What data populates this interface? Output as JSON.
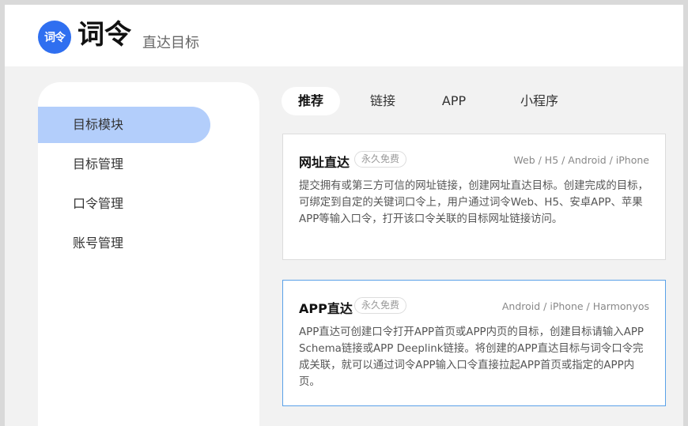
{
  "header": {
    "logo_text": "词令",
    "brand_name": "词令",
    "subtitle": "直达目标"
  },
  "sidebar": {
    "items": [
      {
        "label": "目标模块"
      },
      {
        "label": "目标管理"
      },
      {
        "label": "口令管理"
      },
      {
        "label": "账号管理"
      }
    ]
  },
  "tabs": [
    {
      "label": "推荐"
    },
    {
      "label": "链接"
    },
    {
      "label": "APP"
    },
    {
      "label": "小程序"
    }
  ],
  "cards": [
    {
      "title": "网址直达",
      "badge": "永久免费",
      "platforms": "Web / H5 / Android / iPhone",
      "description": "提交拥有或第三方可信的网址链接，创建网址直达目标。创建完成的目标，可绑定到自定的关键词口令上，用户通过词令Web、H5、安卓APP、苹果APP等输入口令，打开该口令关联的目标网址链接访问。"
    },
    {
      "title": "APP直达",
      "badge": "永久免费",
      "platforms": "Android / iPhone / Harmonyos",
      "description": "APP直达可创建口令打开APP首页或APP内页的目标，创建目标请输入APP Schema链接或APP Deeplink链接。将创建的APP直达目标与词令口令完成关联，就可以通过词令APP输入口令直接拉起APP首页或指定的APP内页。"
    }
  ]
}
